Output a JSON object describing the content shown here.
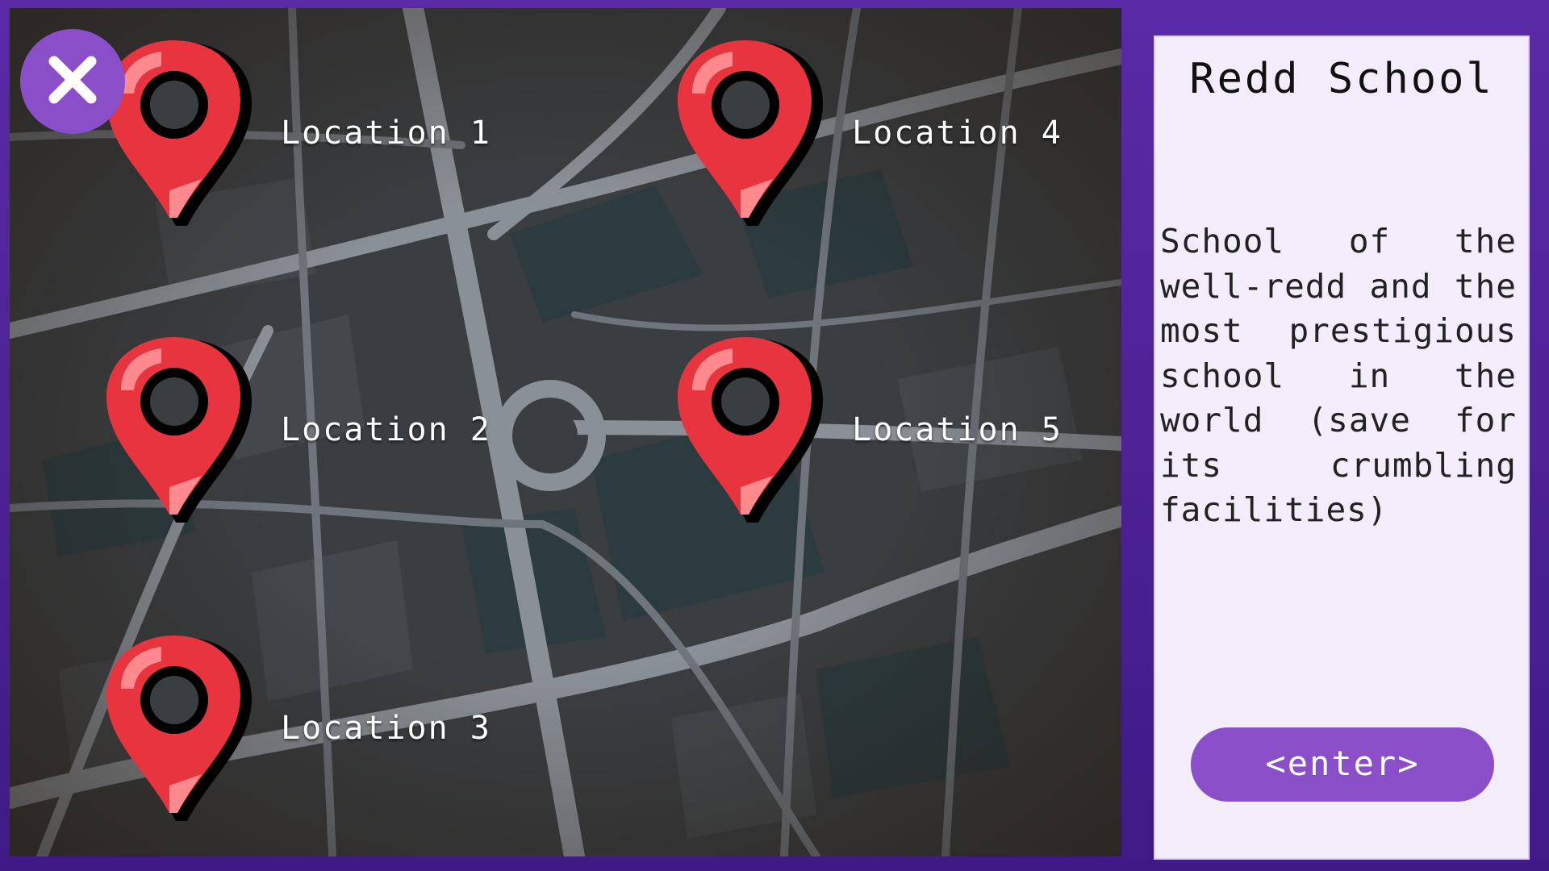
{
  "map": {
    "close_icon": "close-icon",
    "pin_icon": "map-pin-icon",
    "locations": [
      {
        "label": "Location 1"
      },
      {
        "label": "Location 2"
      },
      {
        "label": "Location 3"
      },
      {
        "label": "Location 4"
      },
      {
        "label": "Location 5"
      }
    ]
  },
  "panel": {
    "title": "Redd School",
    "description": "School of the well-redd and the most prestigious school in the world (save for its crumbling facilities)",
    "enter_label": "<enter>"
  },
  "colors": {
    "frame": "#4a1f8e",
    "accent": "#8a4fc8",
    "panel": "#f3ecfb",
    "pin_red": "#e8343f"
  }
}
